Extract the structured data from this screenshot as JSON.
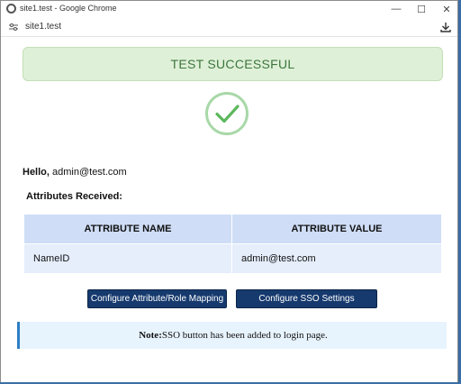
{
  "window": {
    "title": "site1.test - Google Chrome",
    "controls": {
      "minimize": "—",
      "maximize": "☐",
      "close": "✕"
    }
  },
  "addressbar": {
    "url": "site1.test",
    "icons": [
      "tune-icon",
      "download-icon"
    ]
  },
  "banner": {
    "text": "TEST SUCCESSFUL",
    "color": "#3c763d",
    "background": "#dff0d8"
  },
  "check": {
    "icon": "check-circle-icon",
    "color": "#5cb85c"
  },
  "greeting": {
    "label": "Hello,",
    "user": " admin@test.com"
  },
  "attributes": {
    "heading": "Attributes Received:",
    "columns": [
      "ATTRIBUTE NAME",
      "ATTRIBUTE VALUE"
    ],
    "rows": [
      {
        "name": "NameID",
        "value": "admin@test.com"
      }
    ]
  },
  "buttons": {
    "mapping": "Configure Attribute/Role Mapping",
    "sso": "Configure SSO Settings",
    "color": "#163a6e"
  },
  "note": {
    "label": "Note:",
    "text": "SSO button has been added to login page."
  }
}
